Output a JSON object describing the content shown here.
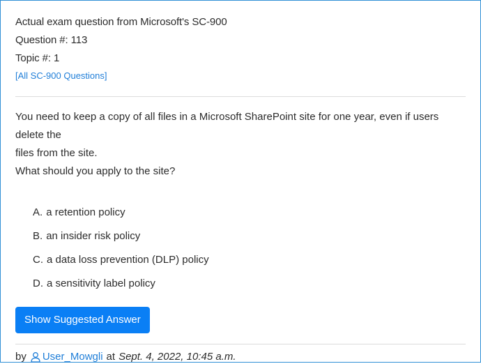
{
  "header": {
    "exam_line": "Actual exam question from Microsoft's SC-900",
    "question_number": "Question #: 113",
    "topic": "Topic #: 1",
    "all_questions_link": "[All SC-900 Questions]"
  },
  "question": {
    "text_line1": "You need to keep a copy of all files in a Microsoft SharePoint site for one year, even if users delete the",
    "text_line2": "files from the site.",
    "prompt": "What should you apply to the site?"
  },
  "choices": [
    {
      "letter": "A.",
      "text": "a retention policy"
    },
    {
      "letter": "B.",
      "text": "an insider risk policy"
    },
    {
      "letter": "C.",
      "text": "a data loss prevention (DLP) policy"
    },
    {
      "letter": "D.",
      "text": "a sensitivity label policy"
    }
  ],
  "actions": {
    "show_answer_label": "Show Suggested Answer"
  },
  "meta": {
    "by": "by",
    "user_icon": "user-icon",
    "username": "User_Mowgli",
    "at": "at",
    "date": "Sept. 4, 2022, 10:45 a.m."
  },
  "colors": {
    "accent": "#0a7ff5",
    "link": "#1f7ed8",
    "border": "#2f8fd6"
  }
}
